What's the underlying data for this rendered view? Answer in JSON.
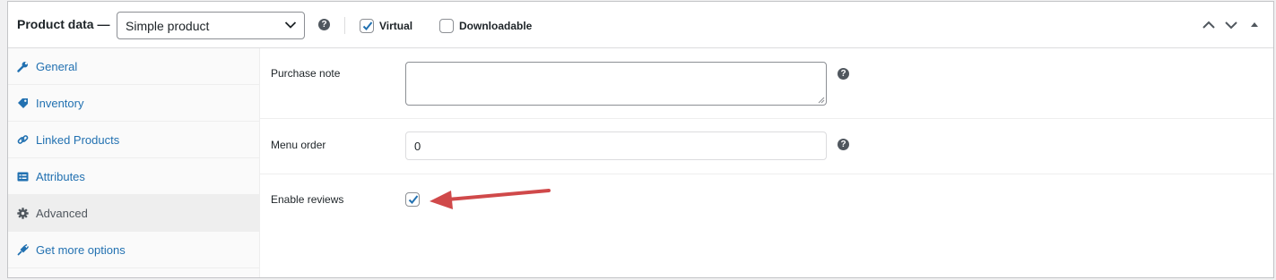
{
  "header": {
    "title": "Product data —",
    "product_type": "Simple product",
    "help_glyph": "?",
    "virtual": {
      "label": "Virtual",
      "checked": true
    },
    "downloadable": {
      "label": "Downloadable",
      "checked": false
    }
  },
  "sidebar": {
    "items": [
      {
        "label": "General",
        "icon": "wrench-icon",
        "active": false
      },
      {
        "label": "Inventory",
        "icon": "tag-icon",
        "active": false
      },
      {
        "label": "Linked Products",
        "icon": "link-icon",
        "active": false
      },
      {
        "label": "Attributes",
        "icon": "list-card-icon",
        "active": false
      },
      {
        "label": "Advanced",
        "icon": "gear-icon",
        "active": true
      },
      {
        "label": "Get more options",
        "icon": "plugin-icon",
        "active": false
      }
    ]
  },
  "fields": {
    "purchase_note": {
      "label": "Purchase note",
      "value": ""
    },
    "menu_order": {
      "label": "Menu order",
      "value": "0"
    },
    "enable_reviews": {
      "label": "Enable reviews",
      "checked": true
    }
  },
  "colors": {
    "link": "#2271b1",
    "annotation_arrow": "#d0494a",
    "checkbox_check": "#2271b1"
  }
}
